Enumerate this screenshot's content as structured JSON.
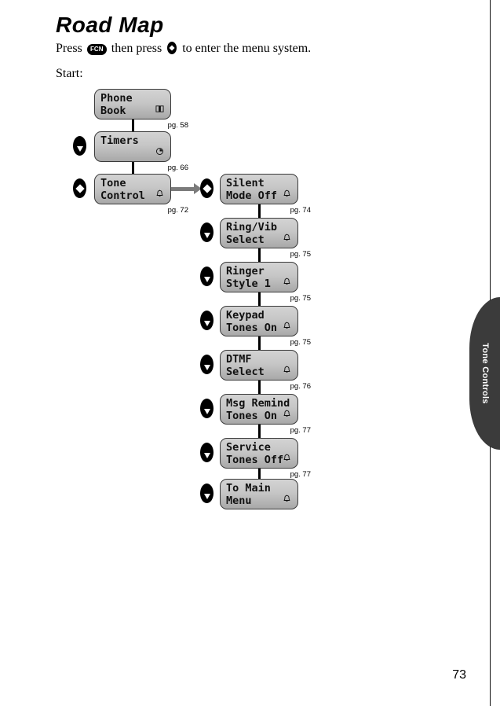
{
  "document": {
    "heading": "Road Map",
    "intro_before_fcn": "Press",
    "fcn_key_label": "FCN",
    "intro_middle": "then press",
    "intro_after_navkey": "to enter the menu system.",
    "start_label": "Start:",
    "page_number": "73",
    "side_tab_label": "Tone Controls"
  },
  "main_column": {
    "nodes": [
      {
        "line1": "Phone",
        "line2": "Book",
        "icon": "book-icon",
        "icon_glyph": "ᴍ",
        "icon_row": 2,
        "page_ref": "pg. 58",
        "key": "none"
      },
      {
        "line1": "Timers",
        "line2": "",
        "icon": "clock-icon",
        "icon_glyph": "◔",
        "icon_row": 2,
        "page_ref": "pg. 66",
        "key": "down"
      },
      {
        "line1": "Tone",
        "line2": "Control",
        "icon": "bell-icon",
        "icon_glyph": "♁",
        "icon_row": 2,
        "page_ref": "pg. 72",
        "key": "up-down"
      }
    ]
  },
  "tone_branch": {
    "nodes": [
      {
        "line1": "Silent",
        "line2": "Mode Off",
        "icon": "bell-icon",
        "page_ref": "pg. 74",
        "key": "up-down"
      },
      {
        "line1": "Ring/Vib",
        "line2": "Select",
        "icon": "bell-icon",
        "page_ref": "pg. 75",
        "key": "down"
      },
      {
        "line1": "Ringer",
        "line2": "Style 1",
        "icon": "bell-icon",
        "page_ref": "pg. 75",
        "key": "down"
      },
      {
        "line1": "Keypad",
        "line2": "Tones On",
        "icon": "bell-icon",
        "page_ref": "pg. 75",
        "key": "down"
      },
      {
        "line1": "DTMF",
        "line2": "Select",
        "icon": "bell-icon",
        "page_ref": "pg. 76",
        "key": "down"
      },
      {
        "line1": "Msg Remind",
        "line2": "Tones On",
        "icon": "bell-icon",
        "page_ref": "pg. 77",
        "key": "down"
      },
      {
        "line1": "Service",
        "line2": "Tones Off",
        "icon": "bell-icon",
        "page_ref": "pg. 77",
        "key": "down"
      },
      {
        "line1": "To Main",
        "line2": "Menu",
        "icon": "bell-icon",
        "page_ref": "",
        "key": "down"
      }
    ]
  },
  "colors": {
    "lcd_top": "#d3d3d3",
    "lcd_bottom": "#a8a8a8",
    "lcd_border": "#3a3a3a",
    "arrow": "#7b7b7b",
    "tab": "#3b3b3b"
  }
}
